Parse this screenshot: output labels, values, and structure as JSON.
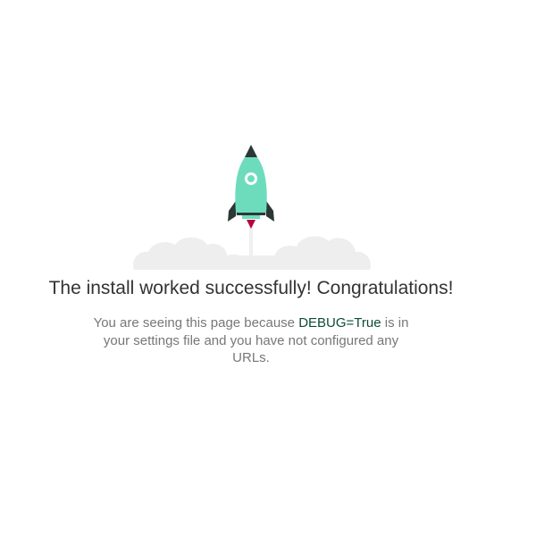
{
  "heading": "The install worked successfully! Congratulations!",
  "description": {
    "before": "You are seeing this page because ",
    "link": "DEBUG=True",
    "after": " is in your settings file and you have not configured any URLs."
  },
  "illustration": {
    "icon": "rocket-launch-icon",
    "colors": {
      "rocket_body": "#6ddcbd",
      "rocket_dark": "#2b3735",
      "flame": "#b8063a",
      "clouds": "#efefef"
    }
  },
  "colors": {
    "heading": "#333333",
    "text": "#777777",
    "debug_highlight": "#0c4b33",
    "background": "#ffffff"
  }
}
